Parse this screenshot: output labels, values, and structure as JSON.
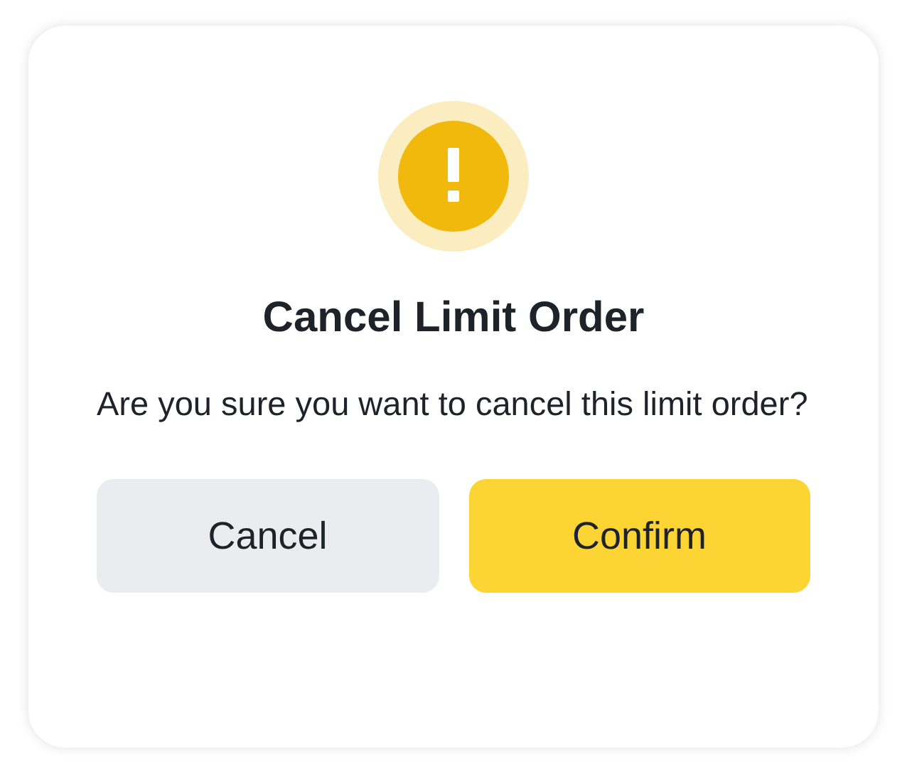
{
  "dialog": {
    "title": "Cancel Limit Order",
    "message": "Are you sure you want to cancel this limit order?",
    "buttons": [
      {
        "label": "Cancel",
        "kind": "secondary"
      },
      {
        "label": "Confirm",
        "kind": "primary"
      }
    ]
  }
}
